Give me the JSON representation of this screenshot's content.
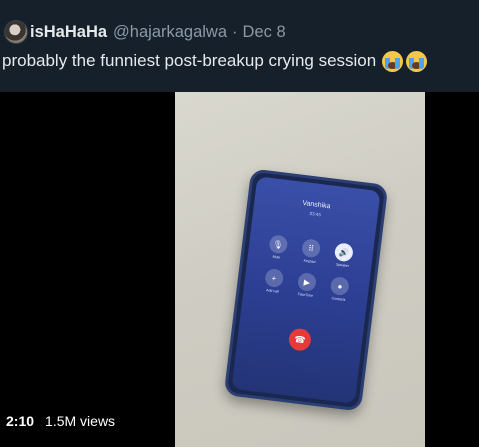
{
  "tweet": {
    "display_name": "isHaHaHa",
    "handle": "@hajarkagalwa",
    "separator": "·",
    "date": "Dec 8",
    "text": "probably the funniest post-breakup crying session",
    "emojis": [
      "loudly-crying-face-icon",
      "loudly-crying-face-icon"
    ]
  },
  "video": {
    "duration": "2:10",
    "views": "1.5M views",
    "call_screen": {
      "caller": "Vanshika",
      "timer": "03:45",
      "buttons": [
        "Mute",
        "Keypad",
        "Speaker",
        "Add call",
        "FaceTime",
        "Contacts"
      ],
      "end_call_icon": "phone-hangup-icon"
    }
  },
  "colors": {
    "background": "#15202b",
    "primary_text": "#e7e9ea",
    "secondary_text": "#8b98a5",
    "end_call": "#e5393a"
  }
}
